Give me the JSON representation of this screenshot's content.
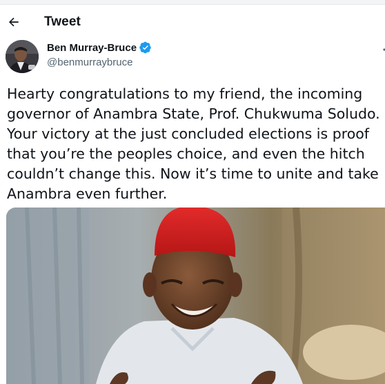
{
  "header": {
    "title": "Tweet",
    "back_icon": "arrow-left-icon"
  },
  "author": {
    "name": "Ben Murray-Bruce",
    "handle": "@benmurraybruce",
    "verified_icon": "verified-badge-icon",
    "verified_color": "#1d9bf0"
  },
  "tweet": {
    "lines": [
      "Hearty congratulations to my friend, the incoming",
      "governor of Anambra State, Prof. Chukwuma Soludo.",
      "Your victory at the just concluded elections is proof",
      "that you’re the peoples choice, and even the hitch",
      "couldn’t change this. Now it’s time to unite and take",
      "Anambra even further."
    ]
  },
  "media": {
    "icon": "photo-of-man-in-red-cap"
  },
  "colors": {
    "text_primary": "#0f1419",
    "text_secondary": "#536471",
    "accent": "#1d9bf0"
  }
}
